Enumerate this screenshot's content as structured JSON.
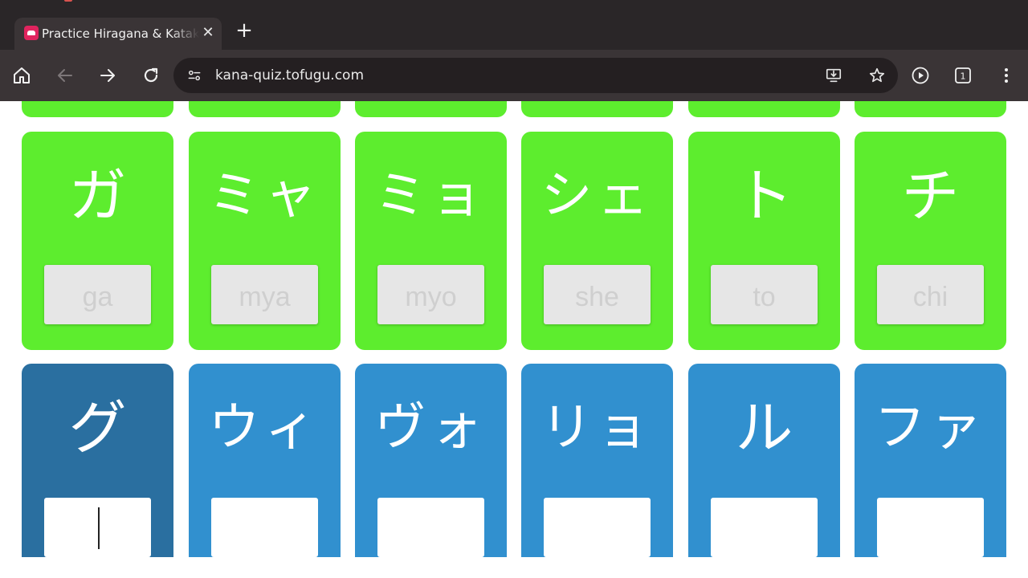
{
  "browser": {
    "tab_title": "Practice Hiragana & Katakana",
    "url": "kana-quiz.tofugu.com",
    "tab_count": "1",
    "colors": {
      "chrome_dark": "#2a2628",
      "toolbar": "#3a3436"
    }
  },
  "quiz": {
    "colors": {
      "correct": "#5ded2e",
      "pending": "#3190cf",
      "active": "#2a6fa0"
    },
    "row_partial": [
      {
        "state": "correct"
      },
      {
        "state": "correct"
      },
      {
        "state": "correct"
      },
      {
        "state": "correct"
      },
      {
        "state": "correct"
      },
      {
        "state": "correct"
      }
    ],
    "row_correct": [
      {
        "kana": "ガ",
        "answer": "ga",
        "state": "correct"
      },
      {
        "kana": "ミャ",
        "answer": "mya",
        "state": "correct"
      },
      {
        "kana": "ミョ",
        "answer": "myo",
        "state": "correct"
      },
      {
        "kana": "シェ",
        "answer": "she",
        "state": "correct"
      },
      {
        "kana": "ト",
        "answer": "to",
        "state": "correct"
      },
      {
        "kana": "チ",
        "answer": "chi",
        "state": "correct"
      }
    ],
    "row_pending": [
      {
        "kana": "グ",
        "answer": "",
        "state": "active"
      },
      {
        "kana": "ウィ",
        "answer": "",
        "state": "pending"
      },
      {
        "kana": "ヴォ",
        "answer": "",
        "state": "pending"
      },
      {
        "kana": "リョ",
        "answer": "",
        "state": "pending"
      },
      {
        "kana": "ル",
        "answer": "",
        "state": "pending"
      },
      {
        "kana": "ファ",
        "answer": "",
        "state": "pending"
      }
    ]
  }
}
